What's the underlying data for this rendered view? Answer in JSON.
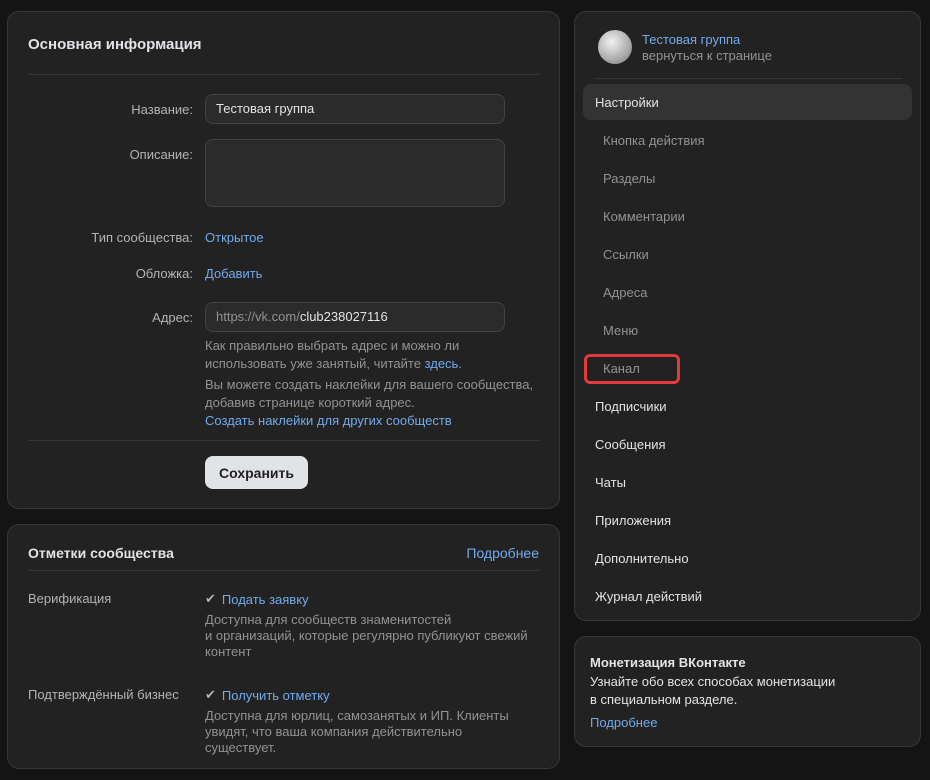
{
  "main": {
    "title": "Основная информация",
    "name_label": "Название:",
    "name_value": "Тестовая группа",
    "description_label": "Описание:",
    "description_value": "",
    "type_label": "Тип сообщества:",
    "type_value": "Открытое",
    "cover_label": "Обложка:",
    "cover_value": "Добавить",
    "address_label": "Адрес:",
    "address_prefix": "https://vk.com/",
    "address_value": "club238027116",
    "hint1_before": "Как правильно выбрать адрес и можно ли",
    "hint1_line2": "использовать уже занятый, читайте ",
    "hint1_link": "здесь",
    "hint1_after": ".",
    "hint2_line1": "Вы можете создать наклейки для вашего сообщества,",
    "hint2_line2": "добавив странице короткий адрес.",
    "hint2_link": "Создать наклейки для других сообществ",
    "save_label": "Сохранить"
  },
  "marks": {
    "title": "Отметки сообщества",
    "more": "Подробнее",
    "verification_label": "Верификация",
    "verification_action": "Подать заявку",
    "verification_desc": [
      "Доступна для сообществ знаменитостей",
      "и организаций, которые регулярно публикуют свежий",
      "контент"
    ],
    "business_label": "Подтверждённый бизнес",
    "business_action": "Получить отметку",
    "business_desc": [
      "Доступна для юрлиц, самозанятых и ИП. Клиенты",
      "увидят, что ваша компания действительно",
      "существует."
    ]
  },
  "nav": {
    "group_name": "Тестовая группа",
    "group_back": "вернуться к странице",
    "settings": "Настройки",
    "sub_items": [
      "Кнопка действия",
      "Разделы",
      "Комментарии",
      "Ссылки",
      "Адреса",
      "Меню",
      "Канал"
    ],
    "top_items": [
      "Подписчики",
      "Сообщения",
      "Чаты",
      "Приложения",
      "Дополнительно",
      "Журнал действий"
    ]
  },
  "money": {
    "title": "Монетизация ВКонтакте",
    "line1": "Узнайте обо всех способах монетизации",
    "line2": "в специальном разделе.",
    "more": "Подробнее"
  },
  "colors": {
    "accent": "#71aaeb",
    "highlight": "#e03a3a",
    "background": "#141414",
    "card": "#222222"
  }
}
